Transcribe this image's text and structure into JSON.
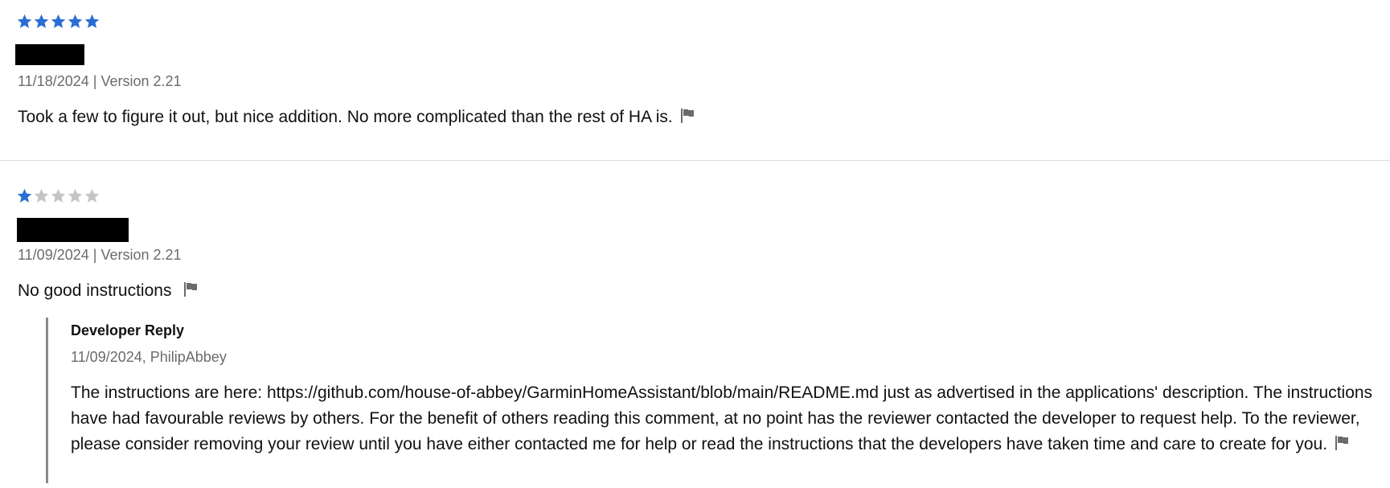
{
  "reviews": [
    {
      "rating": 5,
      "max_rating": 5,
      "date": "11/18/2024",
      "separator": "|",
      "version": "Version 2.21",
      "text": "Took a few to figure it out, but nice addition. No more complicated than the rest of HA is.",
      "flag_icon": "flag-icon"
    },
    {
      "rating": 1,
      "max_rating": 5,
      "date": "11/09/2024",
      "separator": "|",
      "version": "Version 2.21",
      "text": "No good instructions",
      "flag_icon": "flag-icon",
      "developer_reply": {
        "title": "Developer Reply",
        "meta": "11/09/2024, PhilipAbbey",
        "text": "The instructions are here: https://github.com/house-of-abbey/GarminHomeAssistant/blob/main/README.md just as advertised in the applications' description. The instructions have had favourable reviews by others. For the benefit of others reading this comment, at no point has the reviewer contacted the developer to request help. To the reviewer, please consider removing your review until you have either contacted me for help or read the instructions that the developers have taken time and care to create for you."
      }
    }
  ],
  "colors": {
    "star_filled": "#2a6ed4",
    "star_empty": "#c4c4c4",
    "meta_text": "#6b6b6b",
    "reply_border": "#8a8a8a"
  }
}
